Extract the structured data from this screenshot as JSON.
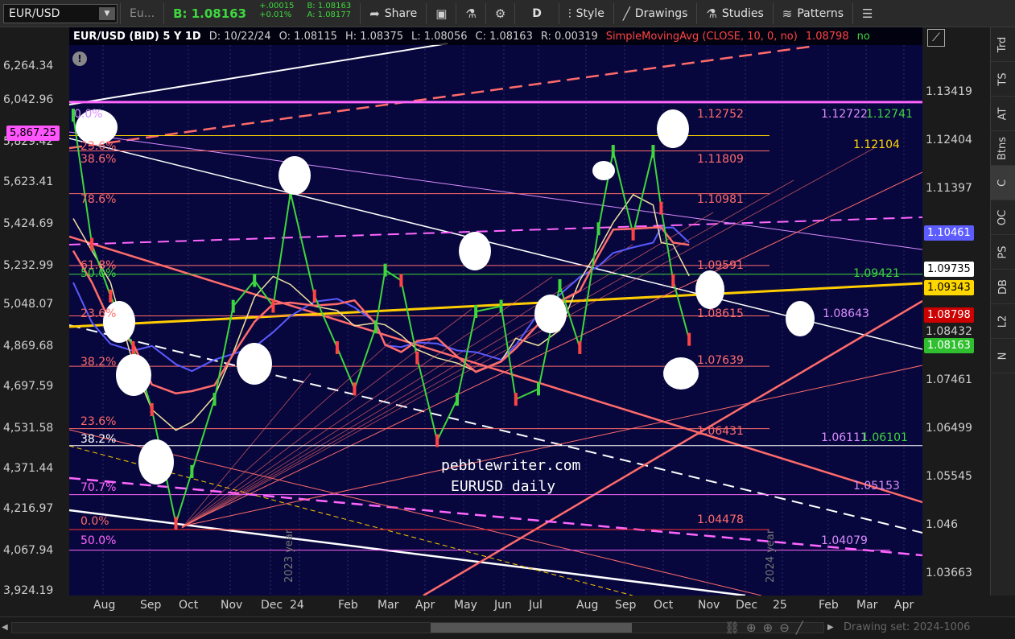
{
  "toolbar": {
    "symbol": "EUR/USD",
    "symbol_desc": "Eu...",
    "bid": "B: 1.08163",
    "change_abs": "+.00015",
    "change_pct": "+0.01%",
    "bid_small": "B: 1.08163",
    "ask_small": "A: 1.08177",
    "share_label": "Share",
    "period_label": "D",
    "style_label": "Style",
    "drawings_label": "Drawings",
    "studies_label": "Studies",
    "patterns_label": "Patterns"
  },
  "infobar": {
    "title": "EUR/USD (BID) 5 Y 1D",
    "date": "D: 10/22/24",
    "open": "O: 1.08115",
    "high": "H: 1.08375",
    "low": "L: 1.08056",
    "close": "C: 1.08163",
    "range": "R: 0.00319",
    "study": "SimpleMovingAvg (CLOSE, 10, 0, no)",
    "study_val": "1.08798",
    "study_flag": "no"
  },
  "left_axis": [
    "6,264.34",
    "6,042.96",
    "5,829.42",
    "5,623.41",
    "5,424.69",
    "5,232.99",
    "5,048.07",
    "4,869.68",
    "4,697.59",
    "4,531.58",
    "4,371.44",
    "4,216.97",
    "4,067.94",
    "3,924.19"
  ],
  "left_tag": "5,867.25",
  "right_axis": [
    "1.13419",
    "1.12404",
    "1.11397",
    "1.10480",
    "1.09420",
    "1.08432",
    "1.07461",
    "1.06499",
    "1.05545",
    "1.046",
    "1.03663"
  ],
  "right_tags": [
    {
      "text": "1.10461",
      "bg": "#5c5cff",
      "fg": "#ffffff"
    },
    {
      "text": "1.09735",
      "bg": "#ffffff",
      "fg": "#000000"
    },
    {
      "text": "1.09343",
      "bg": "#ffd700",
      "fg": "#000000"
    },
    {
      "text": "1.08798",
      "bg": "#cc0000",
      "fg": "#ffffff"
    },
    {
      "text": "1.08163",
      "bg": "#2fbf2f",
      "fg": "#ffffff"
    }
  ],
  "x_axis": [
    "Aug",
    "Sep",
    "Oct",
    "Nov",
    "Dec",
    "24",
    "Feb",
    "Mar",
    "Apr",
    "May",
    "Jun",
    "Jul",
    "Aug",
    "Sep",
    "Oct",
    "Nov",
    "Dec",
    "25",
    "Feb",
    "Mar",
    "Apr"
  ],
  "sidebar": [
    "Trd",
    "TS",
    "AT",
    "Btns",
    "C",
    "OC",
    "PS",
    "DB",
    "L2",
    "N"
  ],
  "fib_left": [
    "0.0%",
    "23.6%",
    "38.6%",
    "78.6%",
    "61.8%",
    "50.0%",
    "23.6%",
    "38.2%",
    "23.6%",
    "38.2%",
    "70.7%",
    "0.0%",
    "50.0%"
  ],
  "price_labels": [
    {
      "text": "1.12752",
      "color": "#ff6b6b"
    },
    {
      "text": "1.12722",
      "color": "#d98cff"
    },
    {
      "text": "1.12741",
      "color": "#3ed63e"
    },
    {
      "text": "1.12104",
      "color": "#ffd700"
    },
    {
      "text": "1.11809",
      "color": "#ff6b6b"
    },
    {
      "text": "1.10981",
      "color": "#ff6b6b"
    },
    {
      "text": "1.09591",
      "color": "#ff6b6b"
    },
    {
      "text": "1.09421",
      "color": "#3ed63e"
    },
    {
      "text": "1.08615",
      "color": "#ff6b6b"
    },
    {
      "text": "1.08643",
      "color": "#d98cff"
    },
    {
      "text": "1.07639",
      "color": "#ff6b6b"
    },
    {
      "text": "1.06431",
      "color": "#ff6b6b"
    },
    {
      "text": "1.06111",
      "color": "#d98cff"
    },
    {
      "text": "1.06101",
      "color": "#3ed63e"
    },
    {
      "text": "1.05153",
      "color": "#d98cff"
    },
    {
      "text": "1.04478",
      "color": "#ff6b6b"
    },
    {
      "text": "1.04079",
      "color": "#d98cff"
    }
  ],
  "watermark": [
    "pebblewriter.com",
    "EURUSD daily"
  ],
  "year_labels": [
    "2023 year",
    "2024 year"
  ],
  "status": {
    "drawing_set": "Drawing set: 2024-1006"
  },
  "chart_data": {
    "type": "line",
    "title": "EUR/USD (BID) 5 Y 1D",
    "y_range_right": [
      1.032,
      1.142
    ],
    "x_range": [
      "2023-07-15",
      "2025-04-15"
    ],
    "series": [
      {
        "name": "EUR/USD",
        "x": [
          "2023-07-18",
          "2023-08-01",
          "2023-08-15",
          "2023-09-01",
          "2023-09-15",
          "2023-10-03",
          "2023-10-15",
          "2023-11-01",
          "2023-11-15",
          "2023-12-01",
          "2023-12-15",
          "2023-12-28",
          "2024-01-15",
          "2024-02-01",
          "2024-02-14",
          "2024-03-01",
          "2024-03-08",
          "2024-03-20",
          "2024-04-01",
          "2024-04-16",
          "2024-05-01",
          "2024-05-15",
          "2024-06-03",
          "2024-06-14",
          "2024-07-01",
          "2024-07-17",
          "2024-08-01",
          "2024-08-15",
          "2024-08-26",
          "2024-09-10",
          "2024-09-25",
          "2024-10-01",
          "2024-10-10",
          "2024-10-22"
        ],
        "values": [
          1.125,
          1.1,
          1.09,
          1.08,
          1.068,
          1.046,
          1.056,
          1.07,
          1.088,
          1.093,
          1.088,
          1.11,
          1.09,
          1.08,
          1.072,
          1.084,
          1.095,
          1.093,
          1.078,
          1.062,
          1.07,
          1.087,
          1.088,
          1.07,
          1.072,
          1.092,
          1.08,
          1.103,
          1.118,
          1.102,
          1.118,
          1.107,
          1.093,
          1.0816
        ]
      }
    ],
    "horizontal_levels": [
      1.12752,
      1.12104,
      1.11809,
      1.10981,
      1.09591,
      1.09421,
      1.08615,
      1.07639,
      1.06431,
      1.06101,
      1.05153,
      1.04478,
      1.04079
    ]
  }
}
